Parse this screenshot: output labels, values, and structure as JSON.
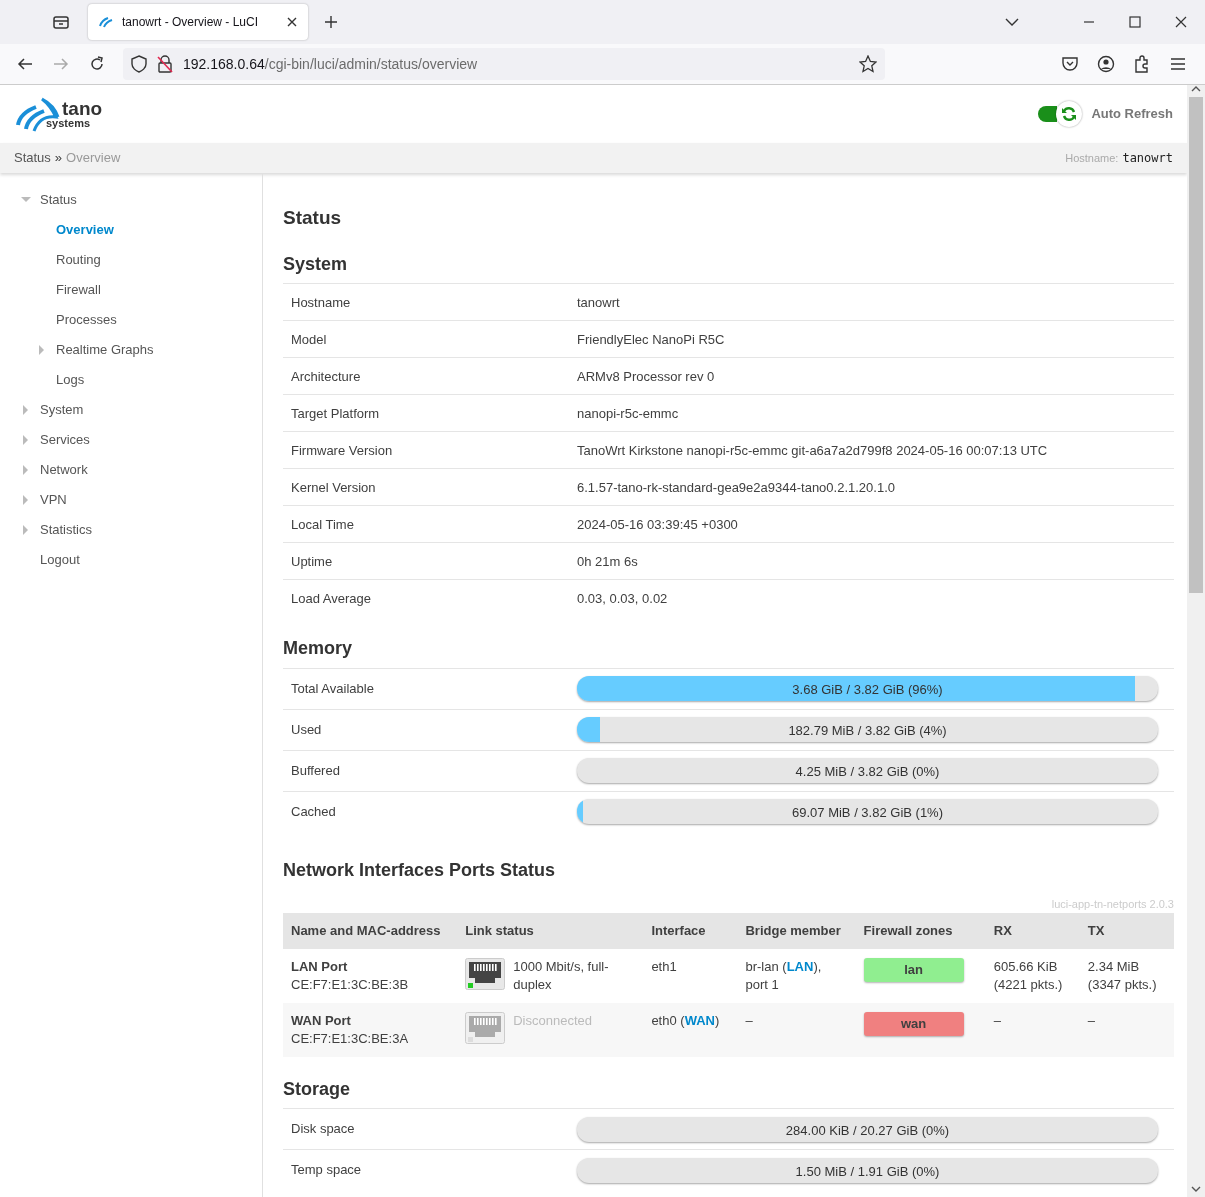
{
  "browser": {
    "tab_title": "tanowrt - Overview - LuCI",
    "url_host": "192.168.0.64",
    "url_path": "/cgi-bin/luci/admin/status/overview"
  },
  "header": {
    "logo_name": "tano",
    "logo_sub": "systems",
    "auto_refresh": {
      "label": "Auto Refresh",
      "on": true
    }
  },
  "breadcrumb": {
    "items": [
      "Status",
      "Overview"
    ],
    "separator": "»",
    "hostname_label": "Hostname:",
    "hostname": "tanowrt"
  },
  "sidebar": {
    "items": [
      {
        "label": "Status",
        "expanded": true,
        "selected": false,
        "children": [
          {
            "label": "Overview",
            "selected": true
          },
          {
            "label": "Routing",
            "selected": false
          },
          {
            "label": "Firewall",
            "selected": false
          },
          {
            "label": "Processes",
            "selected": false
          },
          {
            "label": "Realtime Graphs",
            "expanded": false,
            "selected": false
          },
          {
            "label": "Logs",
            "selected": false
          }
        ]
      },
      {
        "label": "System",
        "expanded": false,
        "selected": false
      },
      {
        "label": "Services",
        "expanded": false,
        "selected": false
      },
      {
        "label": "Network",
        "expanded": false,
        "selected": false
      },
      {
        "label": "VPN",
        "expanded": false,
        "selected": false
      },
      {
        "label": "Statistics",
        "expanded": false,
        "selected": false
      },
      {
        "label": "Logout",
        "selected": false
      }
    ]
  },
  "page_title": "Status",
  "system": {
    "title": "System",
    "rows": [
      {
        "label": "Hostname",
        "value": "tanowrt"
      },
      {
        "label": "Model",
        "value": "FriendlyElec NanoPi R5C"
      },
      {
        "label": "Architecture",
        "value": "ARMv8 Processor rev 0"
      },
      {
        "label": "Target Platform",
        "value": "nanopi-r5c-emmc"
      },
      {
        "label": "Firmware Version",
        "value": "TanoWrt Kirkstone nanopi-r5c-emmc git-a6a7a2d799f8 2024-05-16 00:07:13 UTC"
      },
      {
        "label": "Kernel Version",
        "value": "6.1.57-tano-rk-standard-gea9e2a9344-tano0.2.1.20.1.0"
      },
      {
        "label": "Local Time",
        "value": "2024-05-16 03:39:45 +0300"
      },
      {
        "label": "Uptime",
        "value": "0h 21m 6s"
      },
      {
        "label": "Load Average",
        "value": "0.03, 0.03, 0.02"
      }
    ]
  },
  "memory": {
    "title": "Memory",
    "rows": [
      {
        "label": "Total Available",
        "reading": "3.68 GiB / 3.82 GiB (96%)",
        "level": 0.96
      },
      {
        "label": "Used",
        "reading": "182.79 MiB / 3.82 GiB (4%)",
        "level": 0.04
      },
      {
        "label": "Buffered",
        "reading": "4.25 MiB / 3.82 GiB (0%)",
        "level": 0
      },
      {
        "label": "Cached",
        "reading": "69.07 MiB / 3.82 GiB (1%)",
        "level": 0.01
      }
    ]
  },
  "netports": {
    "title": "Network Interfaces Ports Status",
    "version": "luci-app-tn-netports 2.0.3",
    "columns": [
      "Name and MAC-address",
      "Link status",
      "Interface",
      "Bridge member",
      "Firewall zones",
      "RX",
      "TX"
    ],
    "rows": [
      {
        "name": "LAN Port",
        "mac": "CE:F7:E1:3C:BE:3B",
        "connected": true,
        "link": "1000 Mbit/s, full-duplex",
        "interface": "eth1",
        "interface_link": "",
        "bridge": "br-lan (",
        "bridge_link": "LAN",
        "bridge_after": "), port 1",
        "zone": {
          "label": "lan",
          "color": "#90ee90"
        },
        "rx": "605.66 KiB (4221 pkts.)",
        "tx": "2.34 MiB (3347 pkts.)"
      },
      {
        "name": "WAN Port",
        "mac": "CE:F7:E1:3C:BE:3A",
        "connected": false,
        "link": "Disconnected",
        "interface": "eth0 (",
        "interface_link": "WAN",
        "interface_after": ")",
        "bridge": "–",
        "zone": {
          "label": "wan",
          "color": "#f08080"
        },
        "rx": "–",
        "tx": "–"
      }
    ]
  },
  "storage": {
    "title": "Storage",
    "rows": [
      {
        "label": "Disk space",
        "reading": "284.00 KiB / 20.27 GiB (0%)",
        "level": 0
      },
      {
        "label": "Temp space",
        "reading": "1.50 MiB / 1.91 GiB (0%)",
        "level": 0
      }
    ]
  }
}
